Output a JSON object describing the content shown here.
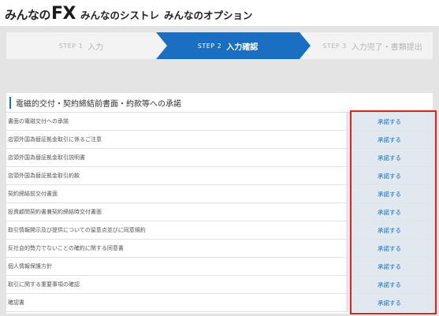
{
  "brand": {
    "fx_prefix": "みんなの",
    "fx_suffix": "FX",
    "systre": "みんなのシストレ",
    "option": "みんなのオプション"
  },
  "steps": [
    {
      "num": "STEP 1",
      "label": "入力"
    },
    {
      "num": "STEP 2",
      "label": "入力確認"
    },
    {
      "num": "STEP 3",
      "label": "入力完了・書類提出"
    }
  ],
  "documents": {
    "title": "電磁的交付・契約締結前書面・約款等への承諾",
    "accept_label": "承諾する",
    "items": [
      "書面の電磁交付への承諾",
      "店頭外国為替証拠金取引に係るご注意",
      "店頭外国為替証拠金取引説明書",
      "店頭外国為替証拠金取引約款",
      "契約締結前交付書面",
      "投資顧問契約書兼契約締結時交付書面",
      "取引情報開示及び提供についての留意点並びに同意規約",
      "反社会的勢力でないことの確約に関する同意書",
      "個人情報保護方針",
      "取引に関する重要事項の確認",
      "確認書"
    ]
  },
  "colors": {
    "accent": "#1a6fc2",
    "highlight": "#e02020"
  }
}
